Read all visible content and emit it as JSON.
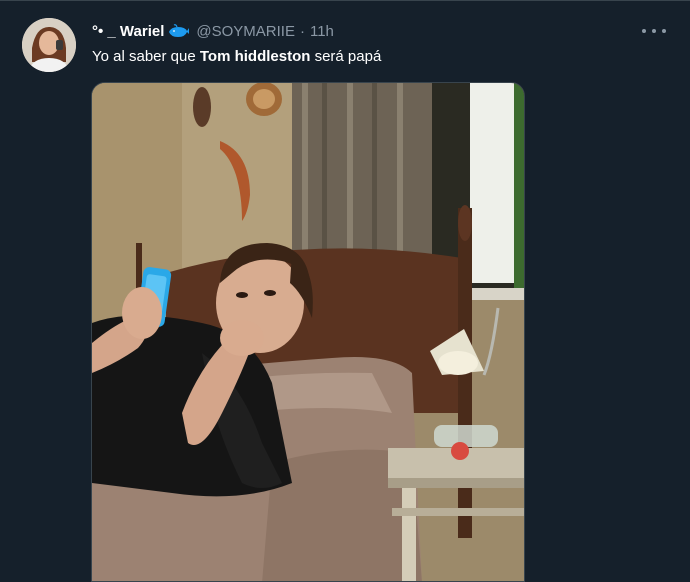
{
  "tweet": {
    "display_name": "°• _ Wariel",
    "badge_icon": "whale-icon",
    "handle": "@SOYMARIIE",
    "separator": "·",
    "time": "11h",
    "text_before": "Yo al saber que ",
    "text_bold": "Tom hiddleston",
    "text_after": " será papá",
    "more_icon": "more-horizontal-icon",
    "media_description_icon": "photo"
  },
  "colors": {
    "background": "#15202b",
    "secondary_text": "#8b98a5",
    "divider": "#38444d"
  }
}
